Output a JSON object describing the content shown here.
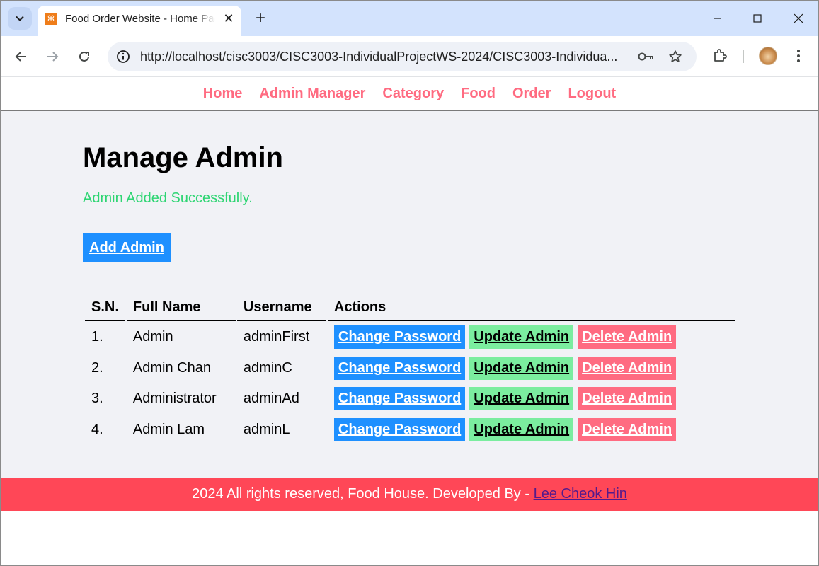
{
  "browser": {
    "tab_title": "Food Order Website - Home Page",
    "url": "http://localhost/cisc3003/CISC3003-IndividualProjectWS-2024/CISC3003-Individua...",
    "tab_close_glyph": "✕",
    "new_tab_glyph": "+",
    "icons": [
      "tab-search-icon",
      "xampp-favicon-icon",
      "back-arrow-icon",
      "forward-arrow-icon",
      "reload-icon",
      "site-info-icon",
      "password-key-icon",
      "bookmark-star-icon",
      "extensions-icon",
      "profile-avatar-icon",
      "kebab-menu-icon",
      "minimize-icon",
      "maximize-icon",
      "close-window-icon"
    ]
  },
  "nav": {
    "items": [
      "Home",
      "Admin Manager",
      "Category",
      "Food",
      "Order",
      "Logout"
    ]
  },
  "page": {
    "title": "Manage Admin",
    "success_message": "Admin Added Successfully.",
    "add_button": "Add Admin"
  },
  "table": {
    "headers": [
      "S.N.",
      "Full Name",
      "Username",
      "Actions"
    ],
    "rows": [
      {
        "sn": "1.",
        "full_name": "Admin",
        "username": "adminFirst"
      },
      {
        "sn": "2.",
        "full_name": "Admin Chan",
        "username": "adminC"
      },
      {
        "sn": "3.",
        "full_name": "Administrator",
        "username": "adminAd"
      },
      {
        "sn": "4.",
        "full_name": "Admin Lam",
        "username": "adminL"
      }
    ],
    "action_labels": {
      "change_password": "Change Password",
      "update": "Update Admin",
      "delete": "Delete Admin"
    }
  },
  "footer": {
    "text": "2024 All rights reserved, Food House. Developed By - ",
    "author_link": "Lee Cheok Hin"
  },
  "colors": {
    "primary": "#1e90ff",
    "success": "#2ed573",
    "update": "#7bed9f",
    "danger": "#ff6b81",
    "footer": "#ff4757",
    "page_bg": "#f1f2f6"
  }
}
